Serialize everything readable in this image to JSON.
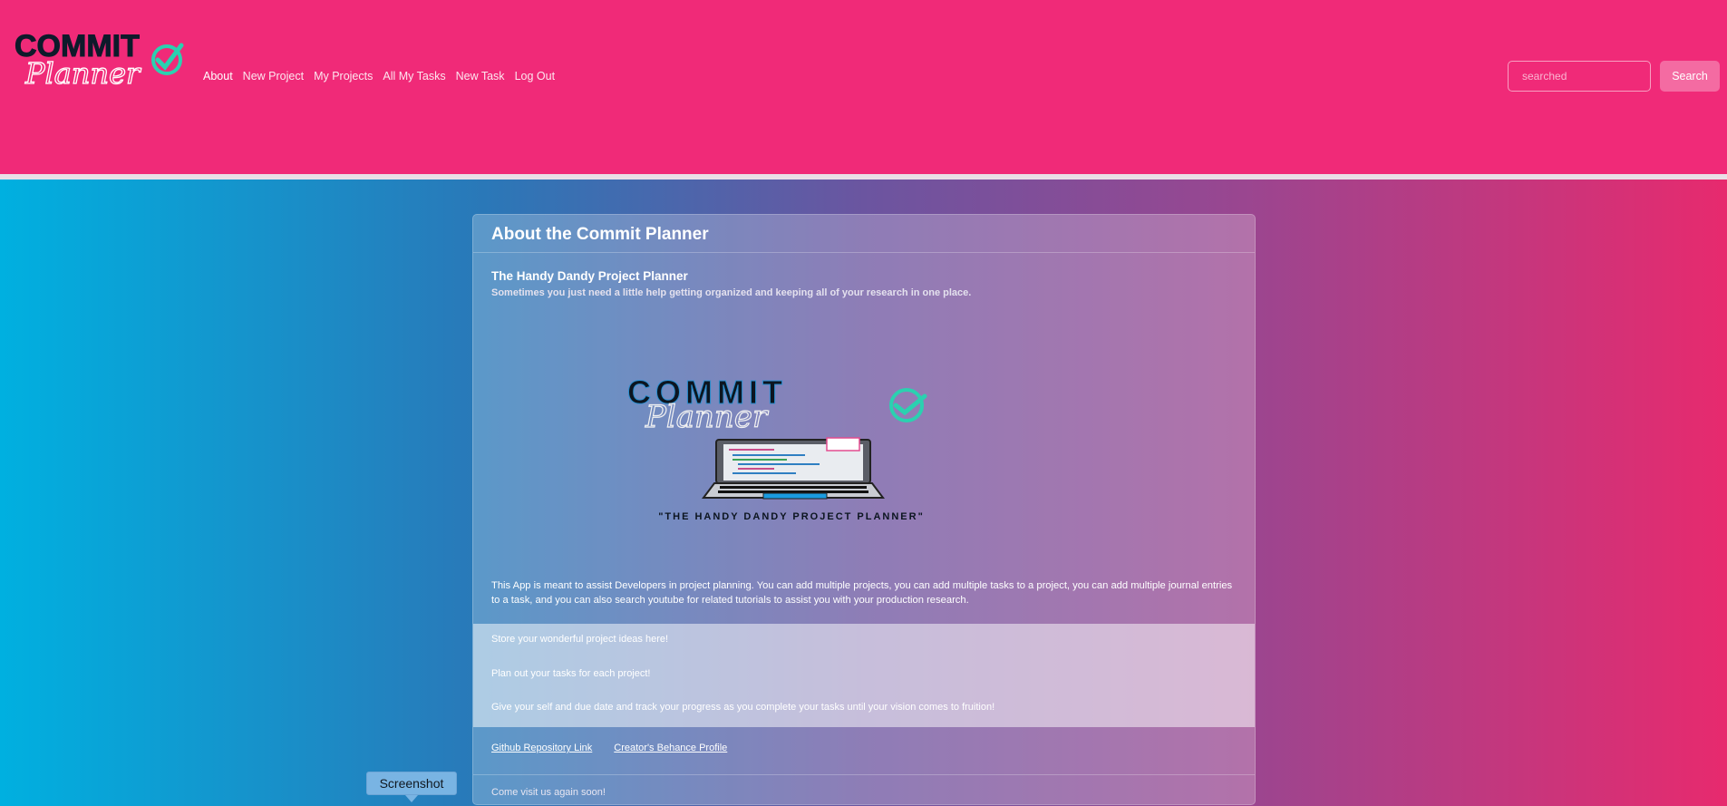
{
  "brand": {
    "logo_word": "COMMIT",
    "logo_script": "Planner"
  },
  "nav": {
    "links": [
      "About",
      "New Project",
      "My Projects",
      "All My Tasks",
      "New Task",
      "Log Out"
    ]
  },
  "search": {
    "placeholder": "searched",
    "button_label": "Search"
  },
  "card": {
    "title": "About the Commit Planner",
    "subtitle": "The Handy Dandy Project Planner",
    "lead": "Sometimes you just need a little help getting organized and keeping all of your research in one place.",
    "hero": {
      "word": "COMMIT",
      "script": "Planner",
      "tagline": "\"THE HANDY DANDY PROJECT PLANNER\""
    },
    "description": "This App is meant to assist Developers in project planning. You can add multiple projects, you can add multiple tasks to a project, you can add multiple journal entries to a task, and you can also search youtube for related tutorials to assist you with your production research.",
    "features": [
      "Store your wonderful project ideas here!",
      "Plan out your tasks for each project!",
      "Give your self and due date and track your progress as you complete your tasks until your vision comes to fruition!"
    ],
    "links": [
      "Github Repository Link",
      "Creator's Behance Profile"
    ],
    "footer": "Come visit us again soon!"
  },
  "tooltip": {
    "label": "Screenshot"
  },
  "colors": {
    "navbar": "#f02a78",
    "accent_teal": "#2bd1b0",
    "search_button": "#f46ba2"
  }
}
